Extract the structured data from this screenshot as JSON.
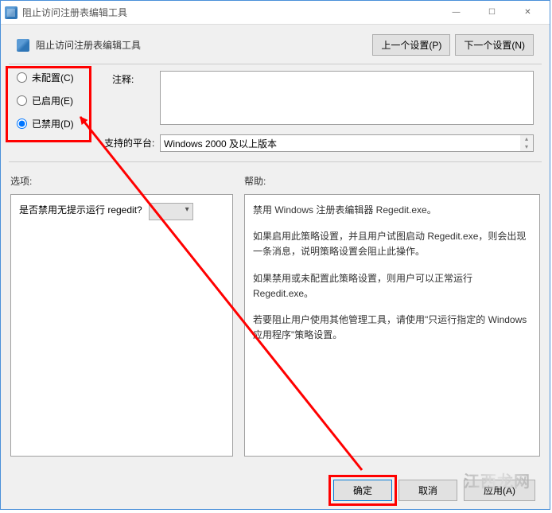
{
  "window": {
    "title": "阻止访问注册表编辑工具"
  },
  "header": {
    "title": "阻止访问注册表编辑工具",
    "prev_btn": "上一个设置(P)",
    "next_btn": "下一个设置(N)"
  },
  "radios": {
    "not_configured": "未配置(C)",
    "enabled": "已启用(E)",
    "disabled": "已禁用(D)"
  },
  "labels": {
    "comment": "注释:",
    "platform": "支持的平台:",
    "options": "选项:",
    "help": "帮助:"
  },
  "platform_text": "Windows 2000 及以上版本",
  "options": {
    "silent_prompt": "是否禁用无提示运行 regedit?"
  },
  "help": {
    "p1": "禁用 Windows 注册表编辑器 Regedit.exe。",
    "p2": "如果启用此策略设置，并且用户试图启动 Regedit.exe，则会出现一条消息，说明策略设置会阻止此操作。",
    "p3": "如果禁用或未配置此策略设置，则用户可以正常运行 Regedit.exe。",
    "p4": "若要阻止用户使用其他管理工具，请使用\"只运行指定的 Windows 应用程序\"策略设置。"
  },
  "buttons": {
    "ok": "确定",
    "cancel": "取消",
    "apply": "应用(A)"
  },
  "window_controls": {
    "minimize": "—",
    "maximize": "☐",
    "close": "✕"
  },
  "watermark": "江西龙网"
}
